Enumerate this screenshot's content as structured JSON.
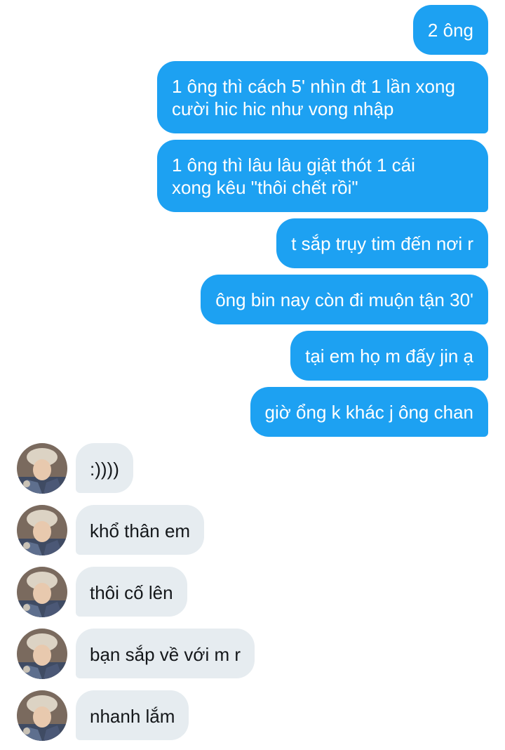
{
  "conversation": {
    "sent": [
      {
        "text": "2 ông"
      },
      {
        "text": "1 ông thì cách 5' nhìn đt 1 lần xong\ncười hic hic như vong nhập"
      },
      {
        "text": "1 ông thì lâu lâu giật thót 1 cái\nxong kêu \"thôi chết rồi\""
      },
      {
        "text": "t sắp trụy tim đến nơi r"
      },
      {
        "text": "ông bin nay còn đi muộn tận 30'"
      },
      {
        "text": "tại em họ m đấy jin ạ"
      },
      {
        "text": "giờ ổng k khác j ông chan"
      }
    ],
    "received": [
      {
        "text": ":))))",
        "avatar": "contact-avatar"
      },
      {
        "text": "khổ thân em",
        "avatar": "contact-avatar"
      },
      {
        "text": "thôi cố lên",
        "avatar": "contact-avatar"
      },
      {
        "text": "bạn sắp về với m r",
        "avatar": "contact-avatar"
      },
      {
        "text": "nhanh lắm",
        "avatar": "contact-avatar"
      }
    ]
  },
  "colors": {
    "sent_bubble": "#1da1f2",
    "sent_text": "#ffffff",
    "received_bubble": "#e6ecf0",
    "received_text": "#14171a"
  }
}
